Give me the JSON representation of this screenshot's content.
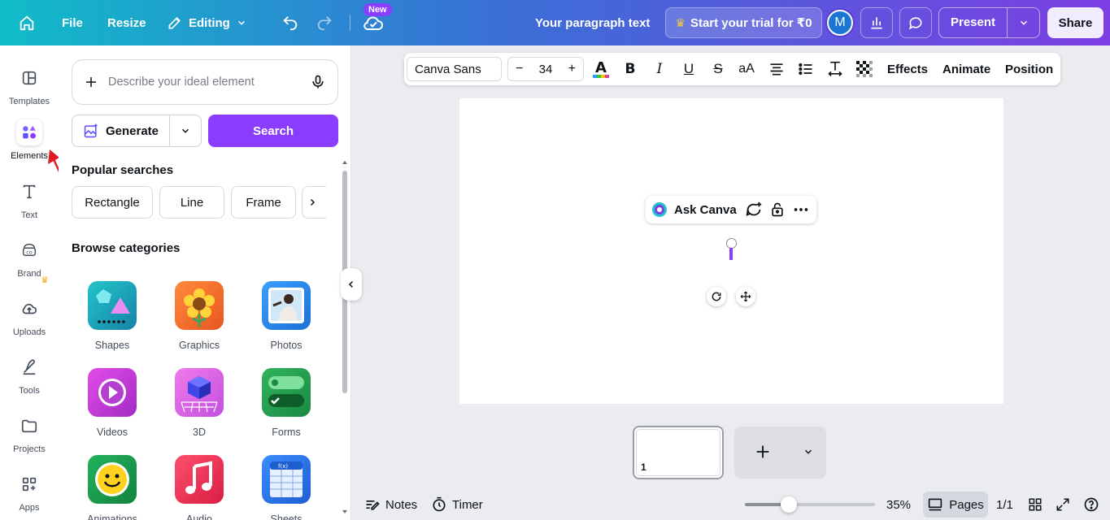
{
  "topbar": {
    "file": "File",
    "resize": "Resize",
    "editing": "Editing",
    "new_badge": "New",
    "doc_title": "Your paragraph text",
    "trial": "Start your trial for ₹0",
    "avatar_initial": "M",
    "present": "Present",
    "share": "Share"
  },
  "rail": {
    "items": [
      {
        "label": "Templates",
        "icon": "templates-icon"
      },
      {
        "label": "Elements",
        "icon": "elements-icon"
      },
      {
        "label": "Text",
        "icon": "text-icon"
      },
      {
        "label": "Brand",
        "icon": "brand-icon"
      },
      {
        "label": "Uploads",
        "icon": "uploads-icon"
      },
      {
        "label": "Tools",
        "icon": "tools-icon"
      },
      {
        "label": "Projects",
        "icon": "projects-icon"
      },
      {
        "label": "Apps",
        "icon": "apps-icon"
      }
    ]
  },
  "panel": {
    "describe_placeholder": "Describe your ideal element",
    "generate": "Generate",
    "search": "Search",
    "popular_title": "Popular searches",
    "chips": [
      "Rectangle",
      "Line",
      "Frame"
    ],
    "browse_title": "Browse categories",
    "categories": [
      {
        "label": "Shapes"
      },
      {
        "label": "Graphics"
      },
      {
        "label": "Photos"
      },
      {
        "label": "Videos"
      },
      {
        "label": "3D"
      },
      {
        "label": "Forms"
      },
      {
        "label": "Animations"
      },
      {
        "label": "Audio"
      },
      {
        "label": "Sheets"
      }
    ]
  },
  "text_toolbar": {
    "font": "Canva Sans",
    "size": "34",
    "case_label": "aA",
    "effects": "Effects",
    "animate": "Animate",
    "position": "Position"
  },
  "canvas": {
    "ask_canva": "Ask Canva"
  },
  "pages": {
    "thumb_number": "1"
  },
  "footer": {
    "notes": "Notes",
    "timer": "Timer",
    "zoom": "35%",
    "zoom_level": 0.35,
    "pages": "Pages",
    "page_count": "1/1"
  },
  "colors": {
    "accent": "#8b3dff",
    "topbar_gradient_start": "#10bcc8",
    "topbar_gradient_end": "#7c3ee3",
    "annotation_arrow": "#e01b24"
  }
}
